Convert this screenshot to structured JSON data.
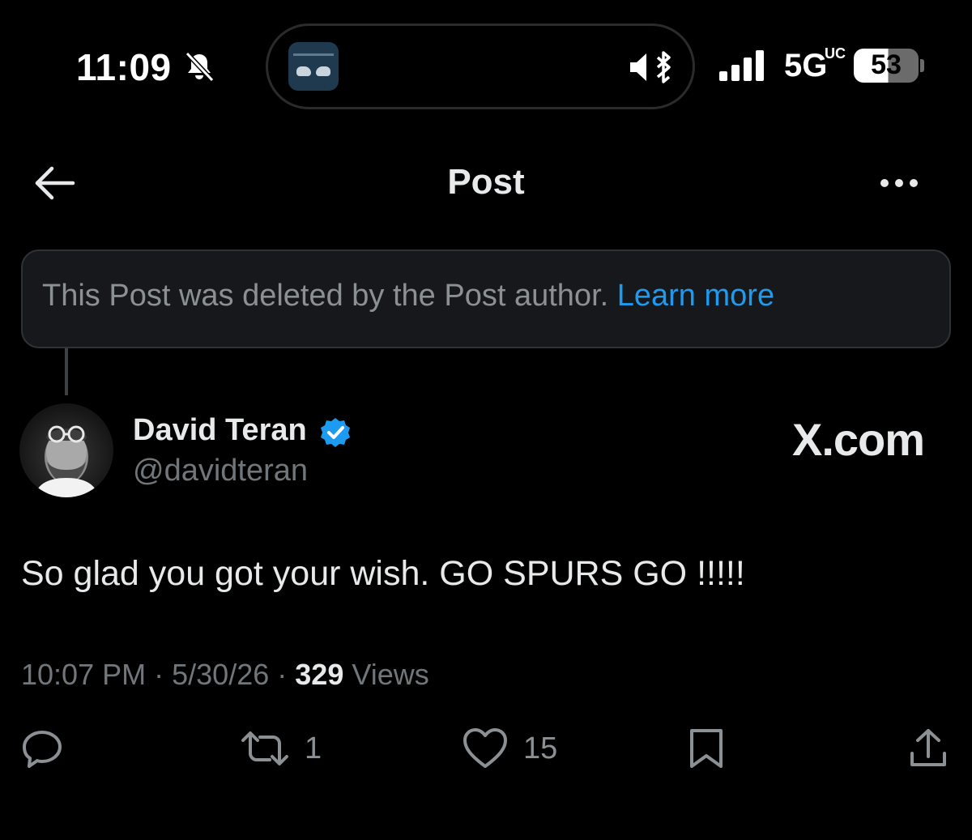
{
  "status_bar": {
    "time": "11:09",
    "network": "5G",
    "network_suffix": "UC",
    "battery": "53",
    "battery_percent": 53,
    "icons": [
      "bell-slash-icon",
      "speaker-mute-icon",
      "bluetooth-icon",
      "cellular-signal-icon",
      "battery-icon"
    ]
  },
  "header": {
    "title": "Post",
    "back_icon": "arrow-left-icon",
    "more_icon": "ellipsis-icon"
  },
  "notice": {
    "text": "This Post was deleted by the Post author.",
    "link": "Learn more"
  },
  "post": {
    "author_name": "David Teran",
    "author_handle": "@davidteran",
    "verified": true,
    "watermark": "X.com",
    "text": "So glad you got your wish. GO SPURS GO !!!!!",
    "time": "10:07 PM",
    "date": "5/30/26",
    "views_count": "329",
    "views_label": "Views",
    "separator": "·"
  },
  "actions": {
    "reply_count": "",
    "repost_count": "1",
    "like_count": "15"
  },
  "colors": {
    "background": "#000000",
    "accent": "#1d9bf0",
    "text_primary": "#e7e9ea",
    "text_secondary": "#71767b",
    "notice_bg": "#16181c"
  }
}
